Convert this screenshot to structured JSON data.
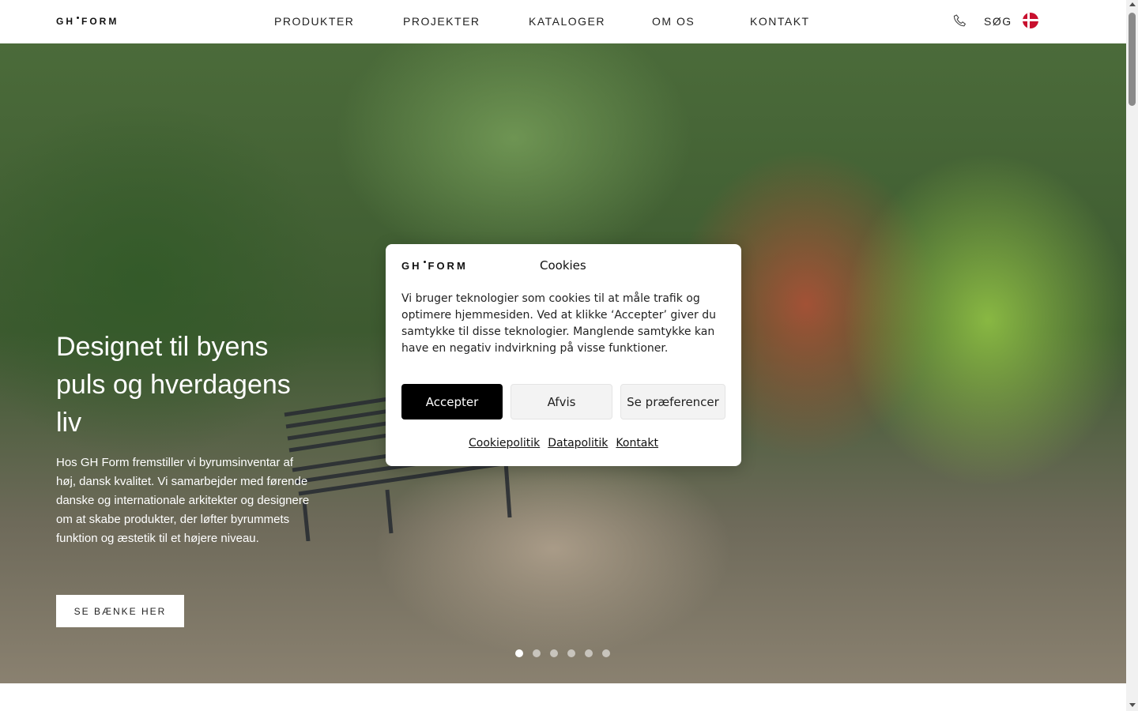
{
  "header": {
    "logo_left": "GH",
    "logo_right": "FORM",
    "nav": [
      {
        "label": "PRODUKTER"
      },
      {
        "label": "PROJEKTER"
      },
      {
        "label": "KATALOGER"
      },
      {
        "label": "OM OS"
      },
      {
        "label": "KONTAKT"
      }
    ],
    "search_label": "SØG",
    "language_flag": "danish-flag-icon"
  },
  "hero": {
    "title": "Designet til byens puls og hverdagens liv",
    "text": "Hos GH Form fremstiller vi byrumsinventar af høj, dansk kvalitet. Vi samarbejder med førende danske og internationale arkitekter og designere om at skabe produkter, der løfter byrummets funktion og æstetik til et højere niveau.",
    "button_label": "SE BÆNKE HER",
    "slides_count": 6,
    "active_slide": 1
  },
  "cookie_modal": {
    "logo_left": "GH",
    "logo_right": "FORM",
    "title": "Cookies",
    "text": "Vi bruger teknologier som cookies til at måle trafik og optimere hjemmesiden. Ved at klikke ‘Accepter’ giver du samtykke til disse teknologier. Manglende samtykke kan have en negativ indvirkning på visse funktioner.",
    "accept_label": "Accepter",
    "deny_label": "Afvis",
    "prefs_label": "Se præferencer",
    "links": {
      "cookie_policy": "Cookiepolitik",
      "data_policy": "Datapolitik",
      "contact": "Kontakt"
    }
  },
  "colors": {
    "accept_button": "#000000",
    "secondary_button": "#f3f3f3",
    "flag_red": "#c8102e"
  }
}
